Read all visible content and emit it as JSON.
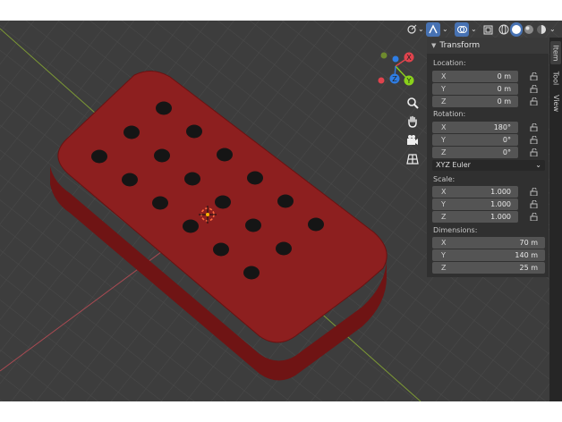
{
  "header": {
    "buttons": [
      {
        "name": "gizmo-toggle",
        "icon": "gizmo-icon",
        "active": false
      },
      {
        "name": "shading-selector",
        "icon": "viewport-shading-icon",
        "active": true
      },
      {
        "name": "overlay-toggle",
        "icon": "overlay-icon",
        "active": false
      }
    ]
  },
  "nav_gizmo": {
    "axes": [
      {
        "label": "X",
        "color": "#e0434d"
      },
      {
        "label": "Y",
        "color": "#8ad11b"
      },
      {
        "label": "Z",
        "color": "#2e7de4"
      }
    ]
  },
  "nav_tools": [
    "zoom-icon",
    "hand-pan-icon",
    "camera-icon",
    "grid-perspective-icon"
  ],
  "panel": {
    "title": "Transform",
    "location": {
      "label": "Location:",
      "x": {
        "axis": "X",
        "value": "0 m"
      },
      "y": {
        "axis": "Y",
        "value": "0 m"
      },
      "z": {
        "axis": "Z",
        "value": "0 m"
      }
    },
    "rotation": {
      "label": "Rotation:",
      "x": {
        "axis": "X",
        "value": "180°"
      },
      "y": {
        "axis": "Y",
        "value": "0°"
      },
      "z": {
        "axis": "Z",
        "value": "0°"
      }
    },
    "rotation_mode": "XYZ Euler",
    "scale": {
      "label": "Scale:",
      "x": {
        "axis": "X",
        "value": "1.000"
      },
      "y": {
        "axis": "Y",
        "value": "1.000"
      },
      "z": {
        "axis": "Z",
        "value": "1.000"
      }
    },
    "dimensions": {
      "label": "Dimensions:",
      "x": {
        "axis": "X",
        "value": "70 m"
      },
      "y": {
        "axis": "Y",
        "value": "140 m"
      },
      "z": {
        "axis": "Z",
        "value": "25 m"
      }
    }
  },
  "tabs": [
    "Item",
    "Tool",
    "View"
  ],
  "colors": {
    "object": "#8b1e1e",
    "viewport_bg": "#3d3d3d",
    "panel_bg": "#303030",
    "accent": "#4772b3"
  }
}
